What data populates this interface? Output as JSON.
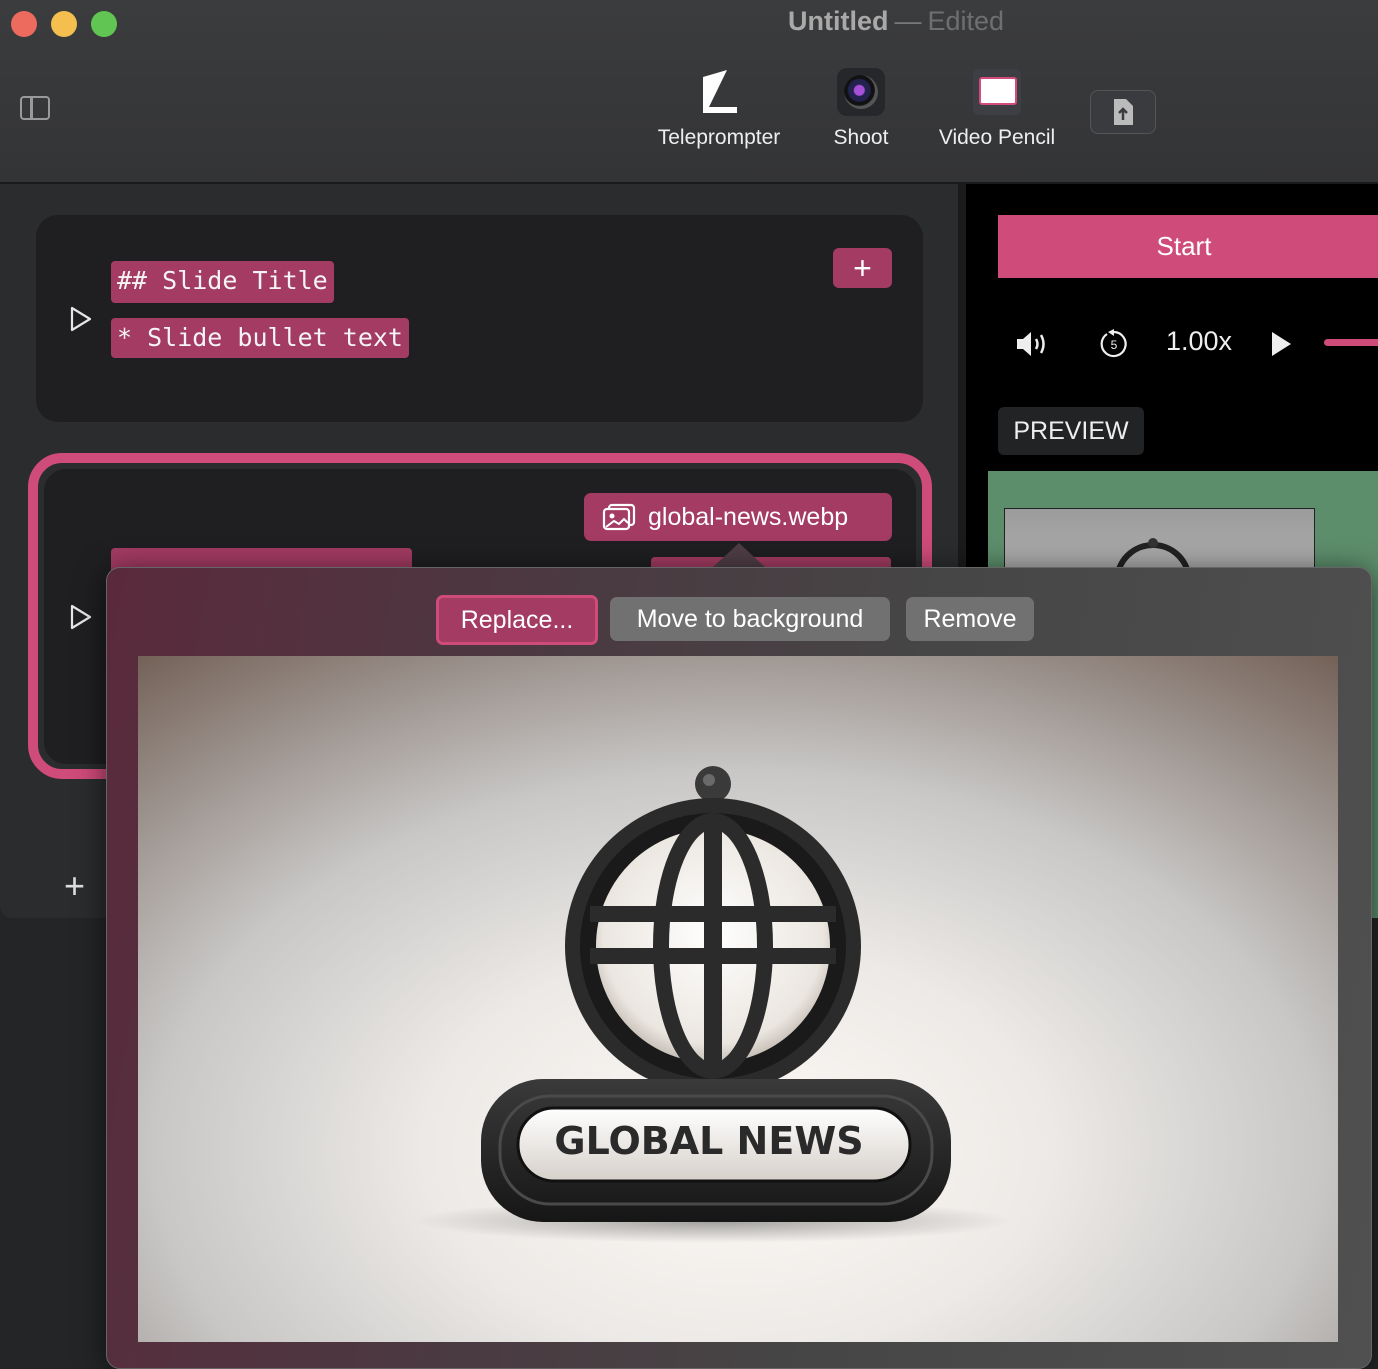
{
  "window": {
    "title": "Untitled",
    "title_separator": "—",
    "title_status": "Edited"
  },
  "toolbar": {
    "items": [
      {
        "label": "Teleprompter",
        "icon": "teleprompter-icon"
      },
      {
        "label": "Shoot",
        "icon": "camera-icon"
      },
      {
        "label": "Video Pencil",
        "icon": "video-pencil-icon"
      }
    ],
    "share_icon": "share-document-icon"
  },
  "editor": {
    "slides": [
      {
        "line1": "## Slide Title",
        "line2": "* Slide bullet text"
      }
    ],
    "attachment": {
      "filename": "global-news.webp",
      "icon": "image-icon"
    },
    "add_slide_symbol": "+"
  },
  "player": {
    "start_label": "Start",
    "speed": "1.00x",
    "preview_label": "PREVIEW",
    "skip_seconds": "5",
    "progress_fraction": 0.05
  },
  "popover": {
    "replace_label": "Replace...",
    "move_label": "Move to background",
    "remove_label": "Remove",
    "image_text": "GLOBAL NEWS"
  },
  "colors": {
    "accent": "#cf4b79",
    "accent_dark": "#a33b62",
    "preview_bg": "#5d8e6c"
  }
}
